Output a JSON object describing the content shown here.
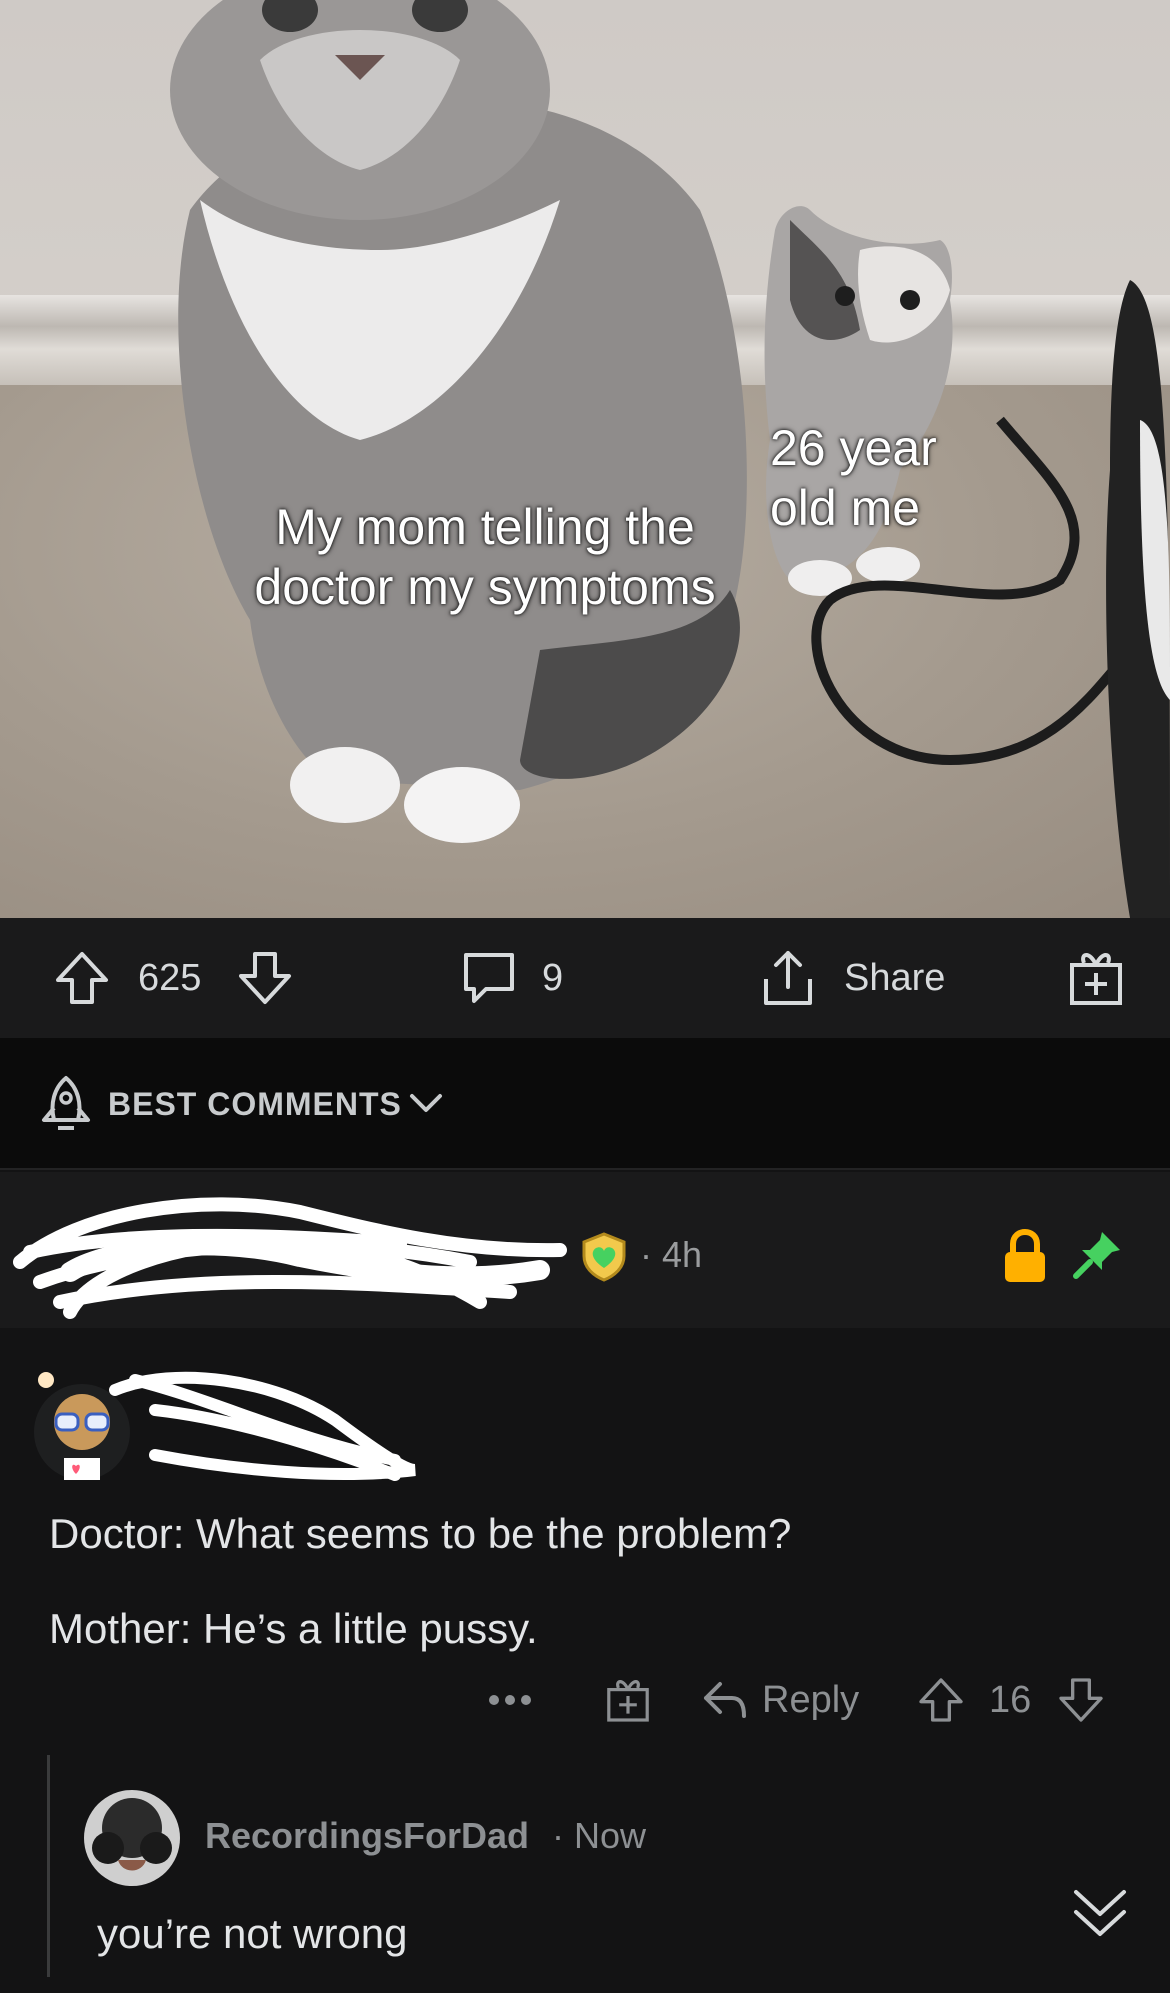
{
  "post": {
    "caption_left": "My mom telling the doctor my symptoms",
    "caption_right": "26 year old me",
    "upvotes": "625",
    "comments": "9",
    "share_label": "Share"
  },
  "sort": {
    "label": "BEST COMMENTS"
  },
  "mod_comment": {
    "time": "· 4h",
    "tag": "MOD"
  },
  "comment": {
    "line1": "Doctor: What seems to be the problem?",
    "line2": "Mother: He’s a little pussy.",
    "reply_label": "Reply",
    "score": "16"
  },
  "reply": {
    "username": "RecordingsForDad",
    "time": "· Now",
    "text": "you’re not wrong"
  },
  "colors": {
    "accent_green": "#46d160",
    "lock_orange": "#ffb000",
    "background": "#131314"
  }
}
